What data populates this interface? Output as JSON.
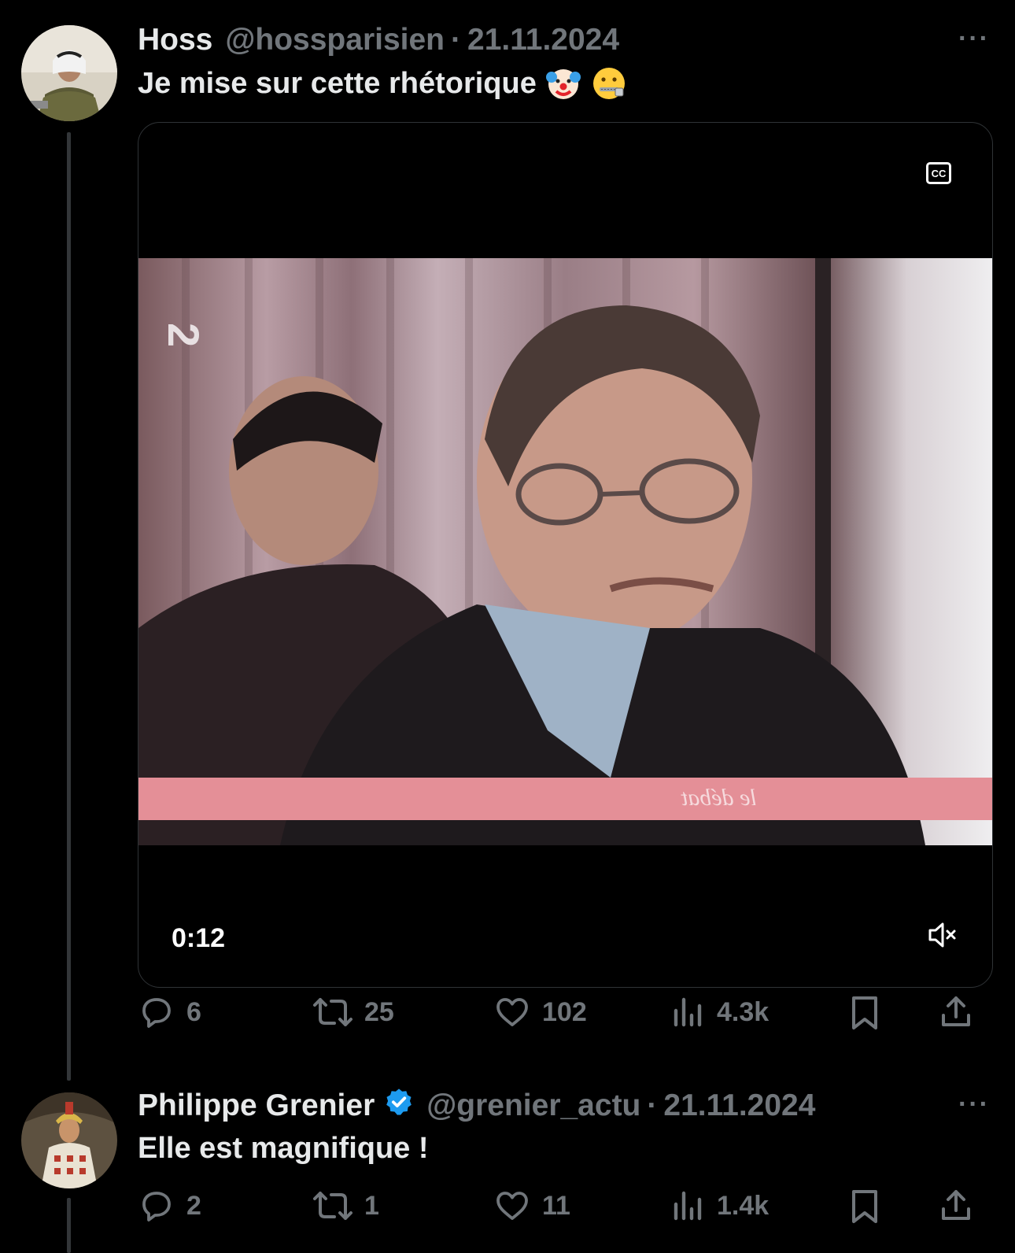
{
  "tweets": [
    {
      "name": "Hoss",
      "handle": "@hossparisien",
      "separator": "·",
      "date": "21.11.2024",
      "text": "Je mise sur cette rhétorique",
      "emojis": [
        "clown-face-emoji",
        "zipper-mouth-face-emoji"
      ],
      "media": {
        "type": "video",
        "timecode": "0:12",
        "captions_label": "CC",
        "muted": true
      },
      "stats": {
        "replies": "6",
        "reposts": "25",
        "likes": "102",
        "views": "4.3k"
      }
    },
    {
      "name": "Philippe Grenier",
      "verified": true,
      "handle": "@grenier_actu",
      "separator": "·",
      "date": "21.11.2024",
      "text": "Elle est magnifique !",
      "stats": {
        "replies": "2",
        "reposts": "1",
        "likes": "11",
        "views": "1.4k"
      }
    }
  ],
  "more_label": "···",
  "colors": {
    "background": "#000000",
    "text": "#e7e9ea",
    "secondary": "#71767b",
    "verified": "#1d9bf0",
    "border": "#2f3336"
  }
}
